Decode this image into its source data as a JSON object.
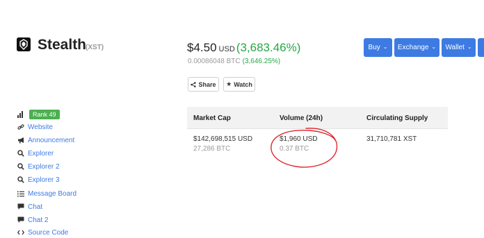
{
  "coin": {
    "name": "Stealth",
    "symbol": "(XST)"
  },
  "price": {
    "value": "$4.50",
    "unit": "USD",
    "change": "(3,683.46%)",
    "btc_value": "0.00086048 BTC",
    "btc_change": "(3,646.25%)"
  },
  "actions": {
    "share_label": "Share",
    "watch_label": "Watch"
  },
  "top_buttons": [
    "Buy",
    "Exchange",
    "Wallet"
  ],
  "sidebar": {
    "rank": "Rank 49",
    "items": [
      {
        "label": "Website",
        "icon": "link-icon"
      },
      {
        "label": "Announcement",
        "icon": "bullhorn-icon"
      },
      {
        "label": "Explorer",
        "icon": "search-icon"
      },
      {
        "label": "Explorer 2",
        "icon": "search-icon"
      },
      {
        "label": "Explorer 3",
        "icon": "search-icon"
      },
      {
        "label": "Message Board",
        "icon": "list-icon"
      },
      {
        "label": "Chat",
        "icon": "chat-bubble-icon"
      },
      {
        "label": "Chat 2",
        "icon": "chat-bubble-icon"
      },
      {
        "label": "Source Code",
        "icon": "code-icon"
      }
    ]
  },
  "stats": {
    "headers": [
      "Market Cap",
      "Volume (24h)",
      "Circulating Supply"
    ],
    "market_cap_usd": "$142,698,515 USD",
    "market_cap_btc": "27,286 BTC",
    "volume_usd": "$1,960 USD",
    "volume_btc": "0.37 BTC",
    "circulating_supply": "31,710,781 XST"
  },
  "colors": {
    "accent_blue": "#3d7be3",
    "positive_green": "#28a745",
    "annotation_red": "#e0242b"
  }
}
